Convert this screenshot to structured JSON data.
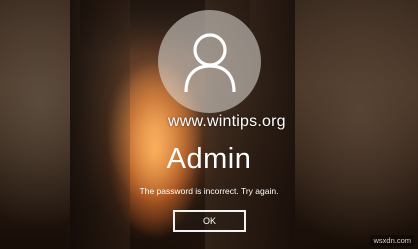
{
  "lock_screen": {
    "avatar_icon": "user-silhouette-icon",
    "watermark": "www.wintips.org",
    "username": "Admin",
    "error_message": "The password is incorrect. Try again.",
    "ok_label": "OK",
    "corner_watermark": "wsxdn.com"
  },
  "colors": {
    "text": "#ffffff",
    "button_border": "#f2f2f2",
    "avatar_bg": "rgba(230,225,220,0.55)"
  }
}
